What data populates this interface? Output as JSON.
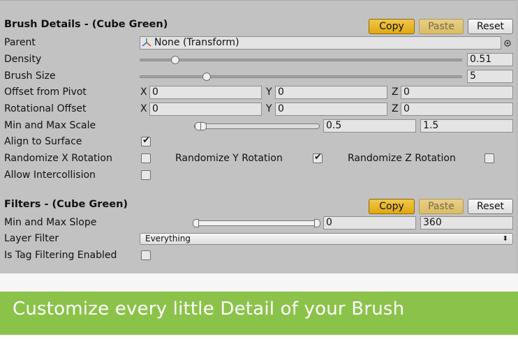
{
  "brush_section": {
    "header": "Brush Details - (Cube Green)",
    "buttons": {
      "copy": "Copy",
      "paste": "Paste",
      "reset": "Reset"
    },
    "parent": {
      "label": "Parent",
      "value": "None (Transform)"
    },
    "density": {
      "label": "Density",
      "value": "0.51",
      "slider_fraction": 0.1
    },
    "brush_size": {
      "label": "Brush Size",
      "value": "5",
      "slider_fraction": 0.2
    },
    "offset_from_pivot": {
      "label": "Offset from Pivot",
      "x": "0",
      "y": "0",
      "z": "0"
    },
    "rotational_offset": {
      "label": "Rotational Offset",
      "x": "0",
      "y": "0",
      "z": "0"
    },
    "axis_labels": {
      "x": "X",
      "y": "Y",
      "z": "Z"
    },
    "min_max_scale": {
      "label": "Min and Max Scale",
      "min": "0.5",
      "max": "1.5"
    },
    "align_to_surface": {
      "label": "Align to Surface",
      "checked": true
    },
    "randomize_x": {
      "label": "Randomize X Rotation",
      "checked": false
    },
    "randomize_y": {
      "label": "Randomize Y Rotation",
      "checked": true
    },
    "randomize_z": {
      "label": "Randomize Z Rotation",
      "checked": false
    },
    "allow_intercollision": {
      "label": "Allow Intercollision",
      "checked": false
    }
  },
  "filters_section": {
    "header": "Filters - (Cube Green)",
    "buttons": {
      "copy": "Copy",
      "paste": "Paste",
      "reset": "Reset"
    },
    "min_max_slope": {
      "label": "Min and Max Slope",
      "min": "0",
      "max": "360"
    },
    "layer_filter": {
      "label": "Layer Filter",
      "value": "Everything"
    },
    "tag_filtering": {
      "label": "Is Tag Filtering Enabled",
      "checked": false
    }
  },
  "banner": {
    "text": "Customize every little Detail of your Brush",
    "color": "#8bc34a"
  },
  "icons": {
    "checkmark": "✔",
    "dropdown_arrow": "⬍"
  }
}
